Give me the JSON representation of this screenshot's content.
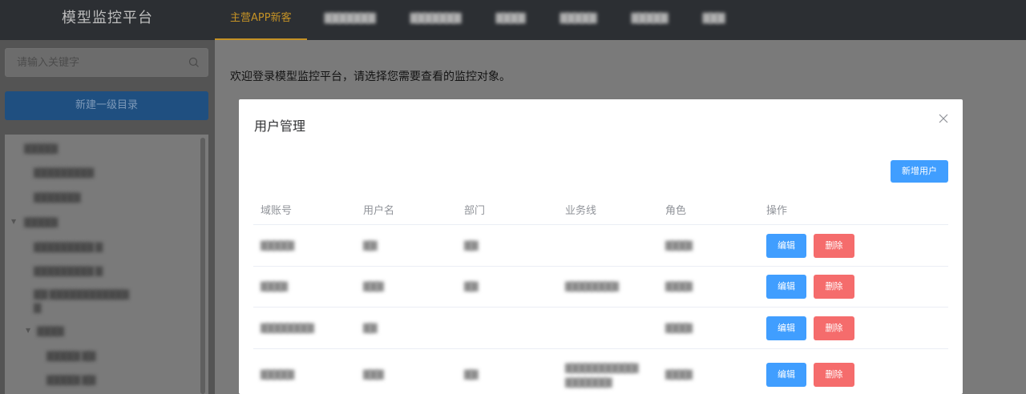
{
  "app": {
    "title": "模型监控平台"
  },
  "nav": {
    "tabs": [
      {
        "label": "主营APP新客",
        "active": true
      },
      {
        "label": "▇▇▇▇▇▇▇",
        "active": false
      },
      {
        "label": "▇▇▇▇▇▇▇",
        "active": false
      },
      {
        "label": "▇▇▇▇",
        "active": false
      },
      {
        "label": "▇▇▇▇▇",
        "active": false
      },
      {
        "label": "▇▇▇▇▇",
        "active": false
      },
      {
        "label": "▇▇▇",
        "active": false
      }
    ]
  },
  "sidebar": {
    "search_placeholder": "请输入关键字",
    "new_dir_button": "新建一级目录",
    "tree": [
      {
        "label": "▇▇▇▇▇"
      },
      {
        "label": "▇▇▇▇▇▇▇▇▇"
      },
      {
        "label": "▇▇▇▇▇▇▇"
      },
      {
        "label": "▇▇▇▇▇"
      },
      {
        "label": "▇▇▇▇▇▇▇▇▇ ▇"
      },
      {
        "label": "▇▇▇▇▇▇▇▇▇ ▇"
      },
      {
        "label": "▇▇ ▇▇▇▇▇▇▇▇▇▇▇▇"
      },
      {
        "label": "▇"
      },
      {
        "label": "▇▇▇▇"
      },
      {
        "label": "▇▇▇▇▇ ▇▇"
      },
      {
        "label": "▇▇▇▇▇ ▇▇"
      }
    ]
  },
  "main": {
    "welcome": "欢迎登录模型监控平台，请选择您需要查看的监控对象。"
  },
  "modal": {
    "title": "用户管理",
    "add_user_button": "新增用户",
    "columns": [
      "域账号",
      "用户名",
      "部门",
      "业务线",
      "角色",
      "操作"
    ],
    "edit_label": "编辑",
    "delete_label": "删除",
    "rows": [
      {
        "account": "▇▇▇▇▇",
        "name": "▇▇",
        "dept": "▇▇",
        "line": "",
        "role": "▇▇▇▇"
      },
      {
        "account": "▇▇▇▇",
        "name": "▇▇▇",
        "dept": "▇▇",
        "line": "▇▇▇▇▇▇▇▇",
        "role": "▇▇▇▇"
      },
      {
        "account": "▇▇▇▇▇▇▇▇",
        "name": "▇▇",
        "dept": "",
        "line": "",
        "role": "▇▇▇▇"
      },
      {
        "account": "▇▇▇▇▇",
        "name": "▇▇▇",
        "dept": "▇▇",
        "line": "▇▇▇▇▇▇▇▇▇▇▇ ▇▇▇▇▇▇▇",
        "role": "▇▇▇▇"
      }
    ]
  },
  "colors": {
    "accent": "#c49226",
    "primary": "#409eff",
    "danger": "#f56c6c"
  }
}
